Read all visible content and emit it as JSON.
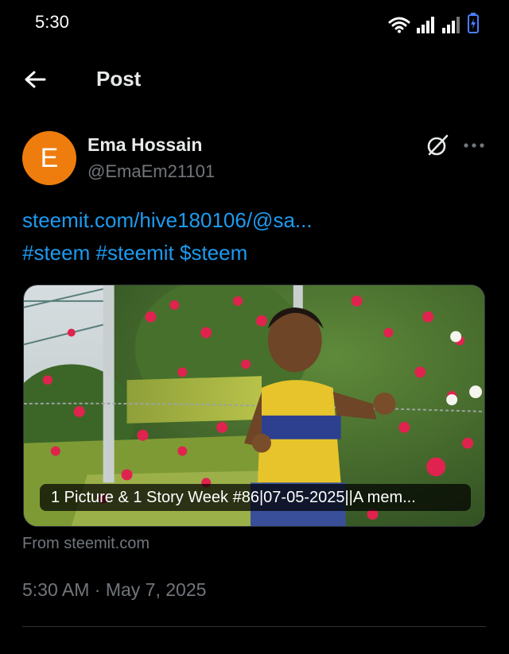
{
  "status_bar": {
    "time": "5:30"
  },
  "header": {
    "title": "Post"
  },
  "post": {
    "author": {
      "avatar_letter": "E",
      "avatar_color": "#ee7d0e",
      "name": "Ema Hossain",
      "handle": "@EmaEm21101"
    },
    "link_text": "steemit.com/hive180106/@sa...",
    "hashtags": [
      "#steem",
      "#steemit",
      "$steem"
    ],
    "card": {
      "caption": "1 Picture & 1 Story Week #86|07-05-2025||A mem...",
      "source": "From steemit.com"
    },
    "timestamp": "5:30 AM · May 7, 2025"
  },
  "colors": {
    "link": "#1d9bf0",
    "muted": "#71767b",
    "background": "#000000"
  },
  "icons": [
    "back-arrow-icon",
    "grok-icon",
    "more-icon",
    "wifi-icon",
    "signal-icon",
    "battery-charging-icon"
  ]
}
